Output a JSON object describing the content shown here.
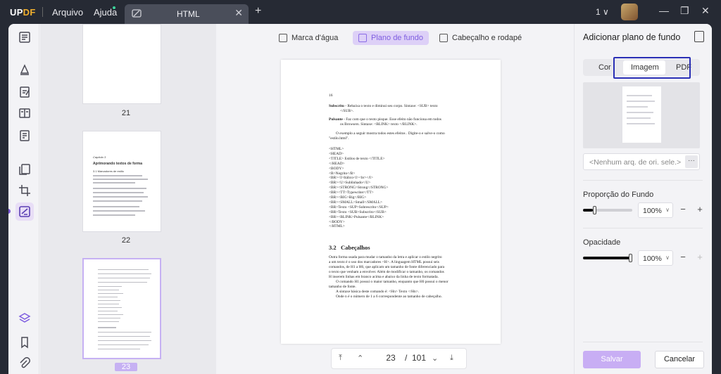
{
  "app": {
    "logo_a": "UP",
    "logo_b": "DF",
    "menu_file": "Arquivo",
    "menu_help": "Ajuda",
    "tab_title": "HTML",
    "plus": "+",
    "version": "1",
    "version_arrow": "∨",
    "min": "—",
    "restore": "❐",
    "close": "✕",
    "tab_close": "✕"
  },
  "thumbs": {
    "p21": "21",
    "p22": "22",
    "p23": "23",
    "t22_cap": "Capítulo 3",
    "t22_title": "Aprimorando textos de forma",
    "t22_sec": "3.1  Marcadores de estilo"
  },
  "toolbar": {
    "watermark": "Marca d'água",
    "background": "Plano de fundo",
    "header_footer": "Cabeçalho e rodapé"
  },
  "page": {
    "num": "16",
    "l1a": "Subscrito",
    "l1b": " - Rebaixa o texto e diminui seu corpo.  Sintaxe: <SUB> texto",
    "l1c": "</SUB>.",
    "l2a": "Pulsante",
    "l2b": " - Faz com que o texto pisque. Esse efeito não funciona em todos",
    "l2c": "os Browsers. Sintaxe: <BLINK> texto </BLINK>.",
    "l3": "O exemplo a seguir mostra todos estes efeitos . Digite-o e salve-o como",
    "l3b": "\"estilo.html\".",
    "code": [
      "<HTML>",
      "<HEAD>",
      "<TITLE> Estilos de texto </TITLE>",
      "</HEAD>",
      "<BODY>",
      "<B>Negrito</B>",
      "<BR><I>Itálico<I><br></I>",
      "<BR><U>Sublinhado</U>",
      "<BR><STRONG>Strong</STRONG>",
      "<BR><TT>Typewriter</TT>",
      "<BR><BIG>Big</BIG>",
      "<BR><SMALL>Small</SMALL>",
      "<BR>Texto <SUP>Sobrescrito</SUP>",
      "<BR>Texto <SUB>Subscrito</SUB>",
      "<BR><BLINK>Pulsante</BLINK>",
      "</BODY>",
      "</HTML>"
    ],
    "h_num": "3.2",
    "h_txt": "Cabeçalhos",
    "body": [
      "Outra forma usada para mudar o tamanho da letra e aplicar o estilo negrito",
      "a um texto é o uso dos marcadores <H>.  A linguagem HTML possui seis",
      "comandos, de H1 a H6, que aplicam um tamanho de fonte diferenciado para",
      "o texto que venham a envolver. Além de modificar o tamanho, os comandos",
      "H inserem linhas em branco acima e abaixo da linha de texto formatada.",
      "O comando H1 possui o maior tamanho, enquanto que H6 possui o menor",
      "tamanho de fonte.",
      "A sintaxe básica deste comando é: <Hn> Texto </Hn>.",
      "Onde n é o número de 1 a 6 correspondente ao tamanho de cabeçalho."
    ]
  },
  "pager": {
    "current": "23",
    "sep": "/",
    "total": "101"
  },
  "panel": {
    "title": "Adicionar plano de fundo",
    "tab_color": "Cor",
    "tab_image": "Imagem",
    "tab_pdf": "PDF",
    "file_placeholder": "<Nenhum arq. de ori. sele.>",
    "file_btn": "···",
    "ratio_label": "Proporção do Fundo",
    "ratio_value": "100%",
    "opacity_label": "Opacidade",
    "opacity_value": "100%",
    "minus": "−",
    "plus": "+",
    "caret": "∨",
    "save": "Salvar",
    "cancel": "Cancelar"
  },
  "sliders": {
    "ratio": 0.2,
    "opacity": 1.0
  },
  "colors": {
    "accent": "#7e5de0",
    "accent_light": "#c8aef4",
    "highlight_box": "#2a2fb5",
    "titlebar": "#262a34"
  }
}
